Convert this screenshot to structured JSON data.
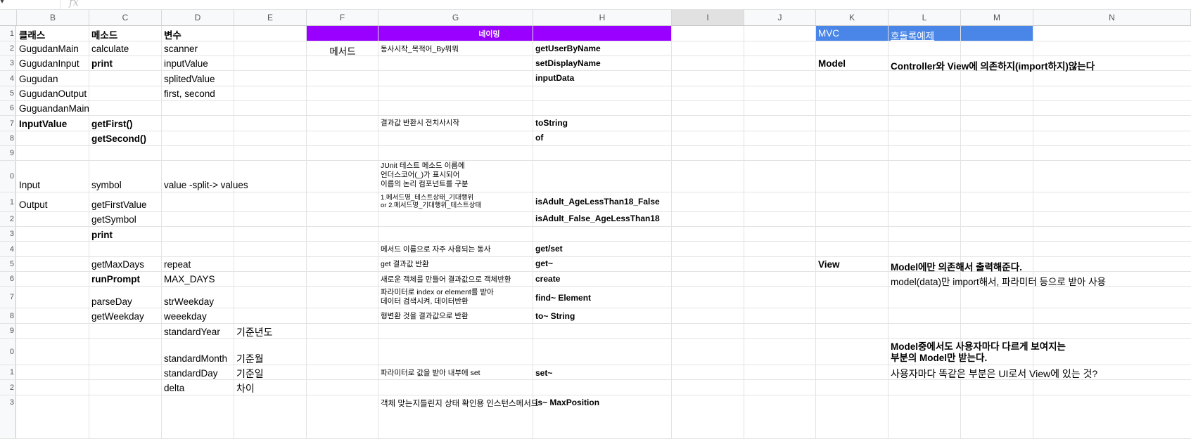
{
  "formula_bar": {
    "fx": "fx"
  },
  "columns": [
    "B",
    "C",
    "D",
    "E",
    "F",
    "G",
    "H",
    "I",
    "J",
    "K",
    "L",
    "M",
    "N"
  ],
  "rows": [
    {
      "num": "1"
    },
    {
      "num": "2"
    },
    {
      "num": "3"
    },
    {
      "num": "4"
    },
    {
      "num": "5"
    },
    {
      "num": "6"
    },
    {
      "num": "7"
    },
    {
      "num": "8"
    },
    {
      "num": "9"
    },
    {
      "num": "0"
    },
    {
      "num": "1"
    },
    {
      "num": "2"
    },
    {
      "num": "3"
    },
    {
      "num": "4"
    },
    {
      "num": "5"
    },
    {
      "num": "6"
    },
    {
      "num": "7"
    },
    {
      "num": "8"
    },
    {
      "num": "9"
    },
    {
      "num": "0"
    },
    {
      "num": "1"
    },
    {
      "num": "2"
    },
    {
      "num": "3"
    }
  ],
  "cells": [
    {
      "id": "b1",
      "text": "클래스",
      "bold": true
    },
    {
      "id": "c1",
      "text": "메소드",
      "bold": true
    },
    {
      "id": "d1",
      "text": "변수",
      "bold": true
    },
    {
      "id": "naming_header",
      "text": "네이밍",
      "bold": true
    },
    {
      "id": "k1",
      "text": "MVC"
    },
    {
      "id": "l1",
      "text": "호돌록예제"
    },
    {
      "id": "b2",
      "text": "GugudanMain"
    },
    {
      "id": "c2",
      "text": "calculate"
    },
    {
      "id": "d2",
      "text": "scanner"
    },
    {
      "id": "f2",
      "text": "메서드"
    },
    {
      "id": "g2",
      "text": "동사시작_목적어_By뭐뭐"
    },
    {
      "id": "h2",
      "text": "getUserByName",
      "bold": true
    },
    {
      "id": "b3",
      "text": "GugudanInput"
    },
    {
      "id": "c3",
      "text": "print",
      "bold": true
    },
    {
      "id": "d3",
      "text": "inputValue"
    },
    {
      "id": "h3",
      "text": "setDisplayName",
      "bold": true
    },
    {
      "id": "k3",
      "text": "Model",
      "bold": true
    },
    {
      "id": "l3",
      "text": "Controller와 View에 의존하지(import하지)않는다"
    },
    {
      "id": "b4",
      "text": "Gugudan"
    },
    {
      "id": "d4",
      "text": "splitedValue"
    },
    {
      "id": "h4",
      "text": "inputData",
      "bold": true
    },
    {
      "id": "b5",
      "text": "GugudanOutput"
    },
    {
      "id": "d5",
      "text": "first, second"
    },
    {
      "id": "b6",
      "text": "GuguandanMain"
    },
    {
      "id": "b7",
      "text": "InputValue",
      "bold": true
    },
    {
      "id": "c7",
      "text": "getFirst()",
      "bold": true
    },
    {
      "id": "g7",
      "text": "결과값 반환시 전치사시작"
    },
    {
      "id": "h7",
      "text": "toString",
      "bold": true
    },
    {
      "id": "c8",
      "text": "getSecond()",
      "bold": true
    },
    {
      "id": "h8",
      "text": "of",
      "bold": true
    },
    {
      "id": "b10",
      "text": "Input"
    },
    {
      "id": "c10",
      "text": "symbol"
    },
    {
      "id": "d10",
      "text": "value -split-> values"
    },
    {
      "id": "g10",
      "text": "JUnit 테스트 메소드 이름에\n언더스코어(_)가 표시되어\n이름의 논리 컴포넌트를 구분"
    },
    {
      "id": "b11",
      "text": "Output"
    },
    {
      "id": "c11",
      "text": "getFirstValue"
    },
    {
      "id": "g11",
      "text": "1.메서드명_테스트상태_기대행위\nor 2.메서드명_기대행위_테스트상태"
    },
    {
      "id": "h11",
      "text": "isAdult_AgeLessThan18_False",
      "bold": true
    },
    {
      "id": "c12",
      "text": "getSymbol"
    },
    {
      "id": "h12",
      "text": "isAdult_False_AgeLessThan18",
      "bold": true
    },
    {
      "id": "c13",
      "text": "print",
      "bold": true
    },
    {
      "id": "g14",
      "text": "메서드 이름으로 자주 사용되는 동사"
    },
    {
      "id": "h14",
      "text": "get/set",
      "bold": true
    },
    {
      "id": "c15",
      "text": "getMaxDays"
    },
    {
      "id": "d15",
      "text": "repeat"
    },
    {
      "id": "g15",
      "text": "get 결과값 반환"
    },
    {
      "id": "h15",
      "text": "get~",
      "bold": true
    },
    {
      "id": "k15",
      "text": "View",
      "bold": true
    },
    {
      "id": "l15",
      "text": "Model에만 의존해서 출력해준다."
    },
    {
      "id": "c16",
      "text": "runPrompt",
      "bold": true
    },
    {
      "id": "d16",
      "text": "MAX_DAYS"
    },
    {
      "id": "g16",
      "text": "새로운 객체를 만들어 결과값으로 객체반환"
    },
    {
      "id": "h16",
      "text": "create",
      "bold": true
    },
    {
      "id": "l16",
      "text": "model(data)만 import해서, 파라미터 등으로 받아 사용"
    },
    {
      "id": "c17",
      "text": "parseDay"
    },
    {
      "id": "d17",
      "text": "strWeekday"
    },
    {
      "id": "g17",
      "text": "파라미터로 index or element를 받아\n데이터 검색시켜, 데이터반환"
    },
    {
      "id": "h17",
      "text": "find~ Element",
      "bold": true
    },
    {
      "id": "c18",
      "text": "getWeekday"
    },
    {
      "id": "d18",
      "text": "weeekday"
    },
    {
      "id": "g18",
      "text": "형변환 것을 결과값으로 반환"
    },
    {
      "id": "h18",
      "text": "to~ String",
      "bold": true
    },
    {
      "id": "d19",
      "text": "standardYear"
    },
    {
      "id": "e19",
      "text": "기준년도"
    },
    {
      "id": "d20",
      "text": "standardMonth"
    },
    {
      "id": "e20",
      "text": "기준월"
    },
    {
      "id": "l20",
      "text": "Model중에서도 사용자마다 다르게 보여지는\n부분의 Model만 받는다."
    },
    {
      "id": "d21",
      "text": "standardDay"
    },
    {
      "id": "e21",
      "text": "기준일"
    },
    {
      "id": "g21",
      "text": "파라미터로 값을 받아 내부에 set"
    },
    {
      "id": "h21",
      "text": "set~",
      "bold": true
    },
    {
      "id": "l21",
      "text": "사용자마다 똑같은 부분은 UI로서 View에 있는 것?"
    },
    {
      "id": "d22",
      "text": "delta"
    },
    {
      "id": "e22",
      "text": "차이"
    },
    {
      "id": "g23",
      "text": "객체 맞는지틀린지 상태 확인용 인스턴스메서드"
    },
    {
      "id": "h23",
      "text": "is~ MaxPosition",
      "bold": true
    }
  ],
  "colors": {
    "naming_band": "#9900ff",
    "mvc_band": "#4a86e8",
    "band_text": "#ffffff",
    "header_bg": "#f8f9fa",
    "grid_line": "#e2e3e3"
  }
}
